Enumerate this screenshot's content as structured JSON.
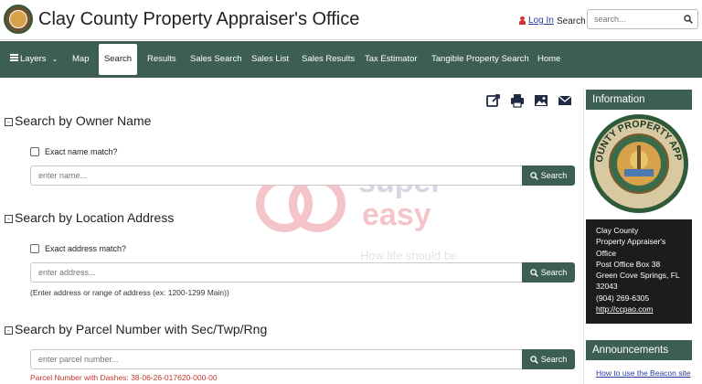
{
  "header": {
    "title": "Clay County Property Appraiser's Office",
    "login_label": "Log In",
    "search_label": "Search",
    "search_placeholder": "search..."
  },
  "nav": {
    "items": [
      {
        "label": "Layers"
      },
      {
        "label": "Map"
      },
      {
        "label": "Search",
        "active": true
      },
      {
        "label": "Results"
      },
      {
        "label": "Sales Search"
      },
      {
        "label": "Sales List"
      },
      {
        "label": "Sales Results"
      },
      {
        "label": "Tax Estimator"
      },
      {
        "label": "Tangible Property Search"
      },
      {
        "label": "Home"
      }
    ]
  },
  "tools": {
    "icons": [
      "share-icon",
      "print-icon",
      "image-icon",
      "email-icon"
    ]
  },
  "owner": {
    "title": "Search by Owner Name",
    "exact_label": "Exact name match?",
    "placeholder": "enter name...",
    "button": "Search"
  },
  "address": {
    "title": "Search by Location Address",
    "exact_label": "Exact address match?",
    "placeholder": "enter address...",
    "button": "Search",
    "hint": "(Enter address or range of address (ex: 1200-1299 Main))"
  },
  "parcel": {
    "title": "Search by Parcel Number with Sec/Twp/Rng",
    "placeholder": "enter parcel number...",
    "button": "Search",
    "hint": "Parcel Number with Dashes: 38-06-26-017620-000-00"
  },
  "watermark": {
    "word1": "super",
    "word2": "easy",
    "tagline": "How life should be"
  },
  "sidebar": {
    "info_title": "Information",
    "seal_text": "CLAY COUNTY PROPERTY APPRAISER",
    "address_lines": [
      "Clay County",
      "Property Appraiser's",
      "Office",
      "Post Office Box 38",
      "Green Cove Springs, FL",
      "32043",
      "(904) 269-6305"
    ],
    "website": "http://ccpao.com",
    "announcements_title": "Announcements",
    "announcement_link": "How to use the Beacon site"
  },
  "colors": {
    "brand_green": "#3d5f52",
    "link_blue": "#2a3a9a",
    "hint_red": "#c0392b"
  }
}
